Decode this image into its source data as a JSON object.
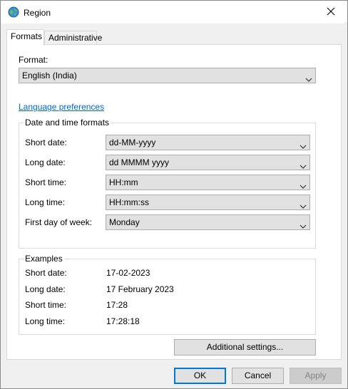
{
  "window": {
    "title": "Region",
    "icons": {
      "app": "globe-icon",
      "close": "close-icon"
    }
  },
  "tabs": [
    {
      "label": "Formats",
      "active": true
    },
    {
      "label": "Administrative",
      "active": false
    }
  ],
  "format": {
    "label": "Format:",
    "value": "English (India)"
  },
  "language_link": "Language preferences",
  "datetime": {
    "title": "Date and time formats",
    "rows": [
      {
        "label": "Short date:",
        "value": "dd-MM-yyyy"
      },
      {
        "label": "Long date:",
        "value": "dd MMMM yyyy"
      },
      {
        "label": "Short time:",
        "value": "HH:mm"
      },
      {
        "label": "Long time:",
        "value": "HH:mm:ss"
      },
      {
        "label": "First day of week:",
        "value": "Monday"
      }
    ]
  },
  "examples": {
    "title": "Examples",
    "rows": [
      {
        "label": "Short date:",
        "value": "17-02-2023"
      },
      {
        "label": "Long date:",
        "value": "17 February 2023"
      },
      {
        "label": "Short time:",
        "value": "17:28"
      },
      {
        "label": "Long time:",
        "value": "17:28:18"
      }
    ]
  },
  "buttons": {
    "additional": "Additional settings...",
    "ok": "OK",
    "cancel": "Cancel",
    "apply": "Apply"
  },
  "colors": {
    "link": "#0066cc",
    "default_border": "#0078d7",
    "background": "#f0f0f0"
  }
}
